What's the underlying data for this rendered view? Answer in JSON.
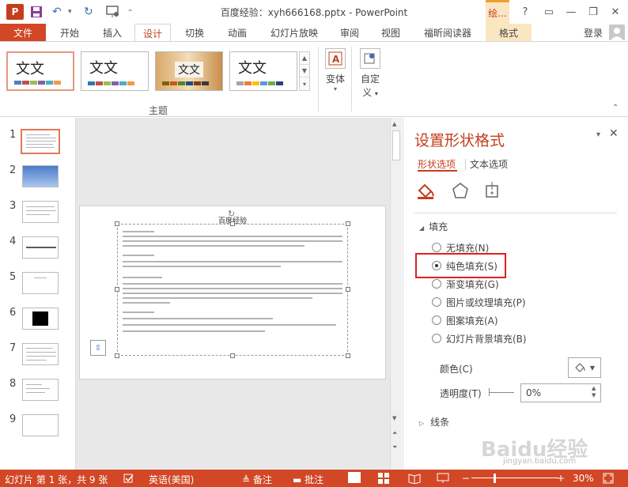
{
  "app": {
    "document_title": "百度经验：xyh666168.pptx - PowerPoint",
    "logo_text": "P",
    "contextual_tab": "绘...",
    "window_buttons": [
      "?",
      "▭",
      "—",
      "❐",
      "✕"
    ]
  },
  "tabs": {
    "file": "文件",
    "items": [
      "开始",
      "插入",
      "设计",
      "切换",
      "动画",
      "幻灯片放映",
      "审阅",
      "视图",
      "福昕阅读器",
      "格式"
    ],
    "active": "设计",
    "login": "登录"
  },
  "ribbon": {
    "themes": [
      {
        "text": "文文",
        "colors": [
          "#4f81bd",
          "#c0504d",
          "#9bbb59",
          "#8064a2",
          "#4bacc6",
          "#f79646"
        ]
      },
      {
        "text": "文文",
        "colors": [
          "#2e75b6",
          "#c0504d",
          "#9bbb59",
          "#8064a2",
          "#4bacc6",
          "#f79646"
        ]
      },
      {
        "text": "文文",
        "colors": [
          "#7f6000",
          "#c55a11",
          "#548235",
          "#1f4e79",
          "#833c0b",
          "#3b3838"
        ]
      },
      {
        "text": "文文",
        "colors": [
          "#a5a5a5",
          "#ed7d31",
          "#ffc000",
          "#5b9bd5",
          "#70ad47",
          "#264478"
        ]
      }
    ],
    "group_label": "主题",
    "variants_label": "变体",
    "customize_label": "自定\n义",
    "customize_line1": "自定",
    "customize_line2": "义"
  },
  "thumbnails": {
    "numbers": [
      "1",
      "2",
      "3",
      "4",
      "5",
      "6",
      "7",
      "8",
      "9"
    ]
  },
  "slide": {
    "title": "百度经验"
  },
  "format_pane": {
    "title": "设置形状格式",
    "tab_shape": "形状选项",
    "tab_text": "文本选项",
    "fill_section": "填充",
    "fill_options": [
      {
        "label": "无填充(N)",
        "selected": false
      },
      {
        "label": "纯色填充(S)",
        "selected": true
      },
      {
        "label": "渐变填充(G)",
        "selected": false
      },
      {
        "label": "图片或纹理填充(P)",
        "selected": false
      },
      {
        "label": "图案填充(A)",
        "selected": false
      },
      {
        "label": "幻灯片背景填充(B)",
        "selected": false
      }
    ],
    "color_label": "颜色(C)",
    "transparency_label": "透明度(T)",
    "transparency_value": "0%",
    "line_section": "线条"
  },
  "status": {
    "slide_info": "幻灯片 第 1 张，共 9 张",
    "language": "英语(美国)",
    "notes": "备注",
    "comments": "批注",
    "zoom": "30%"
  },
  "watermark": {
    "main": "Baidu经验",
    "sub": "jingyan.baidu.com"
  }
}
